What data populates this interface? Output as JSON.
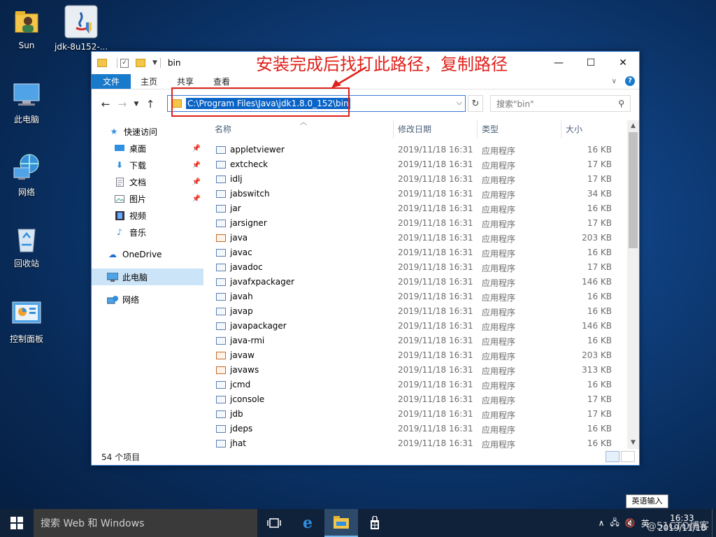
{
  "desktop": {
    "icons": [
      {
        "label": "Sun",
        "icon": "user-folder-icon"
      },
      {
        "label": "jdk-8u152-...",
        "icon": "java-installer-icon"
      },
      {
        "label": "此电脑",
        "icon": "this-pc-icon"
      },
      {
        "label": "网络",
        "icon": "network-icon"
      },
      {
        "label": "回收站",
        "icon": "recycle-bin-icon"
      },
      {
        "label": "控制面板",
        "icon": "control-panel-icon"
      }
    ]
  },
  "annotation": {
    "text": "安装完成后找打此路径，复制路径",
    "color": "#e0201a"
  },
  "window": {
    "title": "bin",
    "controls": {
      "minimize": "—",
      "maximize": "☐",
      "close": "✕"
    },
    "ribbon_tabs": [
      "文件",
      "主页",
      "共享",
      "查看"
    ],
    "address": "C:\\Program Files\\Java\\jdk1.8.0_152\\bin",
    "search_placeholder": "搜索\"bin\"",
    "nav": {
      "quick_access": "快速访问",
      "items": [
        {
          "label": "桌面",
          "icon": "desktop-icon",
          "pinned": true
        },
        {
          "label": "下载",
          "icon": "download-icon",
          "pinned": true
        },
        {
          "label": "文档",
          "icon": "document-icon",
          "pinned": true
        },
        {
          "label": "图片",
          "icon": "picture-icon",
          "pinned": true
        },
        {
          "label": "视频",
          "icon": "video-icon",
          "pinned": false
        },
        {
          "label": "音乐",
          "icon": "music-icon",
          "pinned": false
        }
      ],
      "onedrive": "OneDrive",
      "this_pc": "此电脑",
      "network": "网络"
    },
    "columns": {
      "name": "名称",
      "date": "修改日期",
      "type": "类型",
      "size": "大小"
    },
    "files": [
      {
        "name": "appletviewer",
        "date": "2019/11/18 16:31",
        "type": "应用程序",
        "size": "16 KB",
        "java": false
      },
      {
        "name": "extcheck",
        "date": "2019/11/18 16:31",
        "type": "应用程序",
        "size": "17 KB",
        "java": false
      },
      {
        "name": "idlj",
        "date": "2019/11/18 16:31",
        "type": "应用程序",
        "size": "17 KB",
        "java": false
      },
      {
        "name": "jabswitch",
        "date": "2019/11/18 16:31",
        "type": "应用程序",
        "size": "34 KB",
        "java": false
      },
      {
        "name": "jar",
        "date": "2019/11/18 16:31",
        "type": "应用程序",
        "size": "16 KB",
        "java": false
      },
      {
        "name": "jarsigner",
        "date": "2019/11/18 16:31",
        "type": "应用程序",
        "size": "17 KB",
        "java": false
      },
      {
        "name": "java",
        "date": "2019/11/18 16:31",
        "type": "应用程序",
        "size": "203 KB",
        "java": true
      },
      {
        "name": "javac",
        "date": "2019/11/18 16:31",
        "type": "应用程序",
        "size": "16 KB",
        "java": false
      },
      {
        "name": "javadoc",
        "date": "2019/11/18 16:31",
        "type": "应用程序",
        "size": "17 KB",
        "java": false
      },
      {
        "name": "javafxpackager",
        "date": "2019/11/18 16:31",
        "type": "应用程序",
        "size": "146 KB",
        "java": false
      },
      {
        "name": "javah",
        "date": "2019/11/18 16:31",
        "type": "应用程序",
        "size": "16 KB",
        "java": false
      },
      {
        "name": "javap",
        "date": "2019/11/18 16:31",
        "type": "应用程序",
        "size": "16 KB",
        "java": false
      },
      {
        "name": "javapackager",
        "date": "2019/11/18 16:31",
        "type": "应用程序",
        "size": "146 KB",
        "java": false
      },
      {
        "name": "java-rmi",
        "date": "2019/11/18 16:31",
        "type": "应用程序",
        "size": "16 KB",
        "java": false
      },
      {
        "name": "javaw",
        "date": "2019/11/18 16:31",
        "type": "应用程序",
        "size": "203 KB",
        "java": true
      },
      {
        "name": "javaws",
        "date": "2019/11/18 16:31",
        "type": "应用程序",
        "size": "313 KB",
        "java": true
      },
      {
        "name": "jcmd",
        "date": "2019/11/18 16:31",
        "type": "应用程序",
        "size": "16 KB",
        "java": false
      },
      {
        "name": "jconsole",
        "date": "2019/11/18 16:31",
        "type": "应用程序",
        "size": "17 KB",
        "java": false
      },
      {
        "name": "jdb",
        "date": "2019/11/18 16:31",
        "type": "应用程序",
        "size": "17 KB",
        "java": false
      },
      {
        "name": "jdeps",
        "date": "2019/11/18 16:31",
        "type": "应用程序",
        "size": "16 KB",
        "java": false
      },
      {
        "name": "jhat",
        "date": "2019/11/18 16:31",
        "type": "应用程序",
        "size": "16 KB",
        "java": false
      }
    ],
    "status": "54 个项目"
  },
  "taskbar": {
    "search_placeholder": "搜索 Web 和 Windows",
    "apps": [
      {
        "name": "task-view-icon",
        "active": false
      },
      {
        "name": "edge-icon",
        "active": false
      },
      {
        "name": "file-explorer-icon",
        "active": true
      },
      {
        "name": "store-icon",
        "active": false
      }
    ],
    "ime_label": "英",
    "ime_tooltip": "英语输入",
    "time": "16:33",
    "date": "2019/11/18",
    "watermark": "@51CTO博客"
  }
}
